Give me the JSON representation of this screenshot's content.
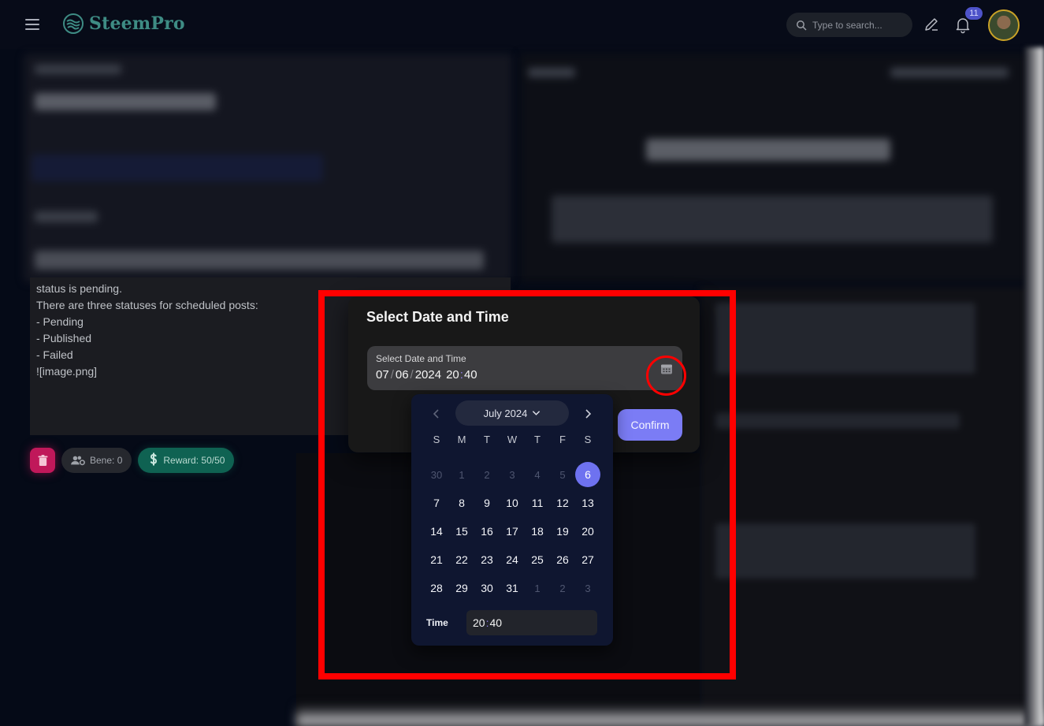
{
  "app": {
    "name": "SteemPro",
    "brand_color": "#3e8c84"
  },
  "header": {
    "search_placeholder": "Type to search...",
    "notification_count": "11"
  },
  "post": {
    "lines": [
      "status is pending.",
      "",
      "There are three statuses for scheduled posts:",
      "",
      "- Pending",
      "- Published",
      "- Failed",
      "",
      "",
      "![image.png]"
    ]
  },
  "post_actions": {
    "bene_label": "Bene: 0",
    "reward_label": "Reward: 50/50"
  },
  "modal": {
    "title": "Select Date and Time",
    "field_label": "Select Date and Time",
    "date": {
      "month": "07",
      "day": "06",
      "year": "2024",
      "hour": "20",
      "minute": "40"
    },
    "confirm_label": "Confirm",
    "accent_color": "#7b7cf5"
  },
  "calendar": {
    "month_label": "July 2024",
    "weekdays": [
      "S",
      "M",
      "T",
      "W",
      "T",
      "F",
      "S"
    ],
    "weeks": [
      [
        "30",
        "1",
        "2",
        "3",
        "4",
        "5",
        "6"
      ],
      [
        "7",
        "8",
        "9",
        "10",
        "11",
        "12",
        "13"
      ],
      [
        "14",
        "15",
        "16",
        "17",
        "18",
        "19",
        "20"
      ],
      [
        "21",
        "22",
        "23",
        "24",
        "25",
        "26",
        "27"
      ],
      [
        "28",
        "29",
        "30",
        "31",
        "1",
        "2",
        "3"
      ]
    ],
    "muted_days": [
      [
        0,
        0
      ],
      [
        0,
        1
      ],
      [
        0,
        2
      ],
      [
        0,
        3
      ],
      [
        0,
        4
      ],
      [
        0,
        5
      ],
      [
        4,
        4
      ],
      [
        4,
        5
      ],
      [
        4,
        6
      ]
    ],
    "selected_day": "6",
    "time_label": "Time",
    "time_hour": "20",
    "time_minute": "40"
  },
  "annotation": {
    "highlight_color": "#ff0000"
  }
}
